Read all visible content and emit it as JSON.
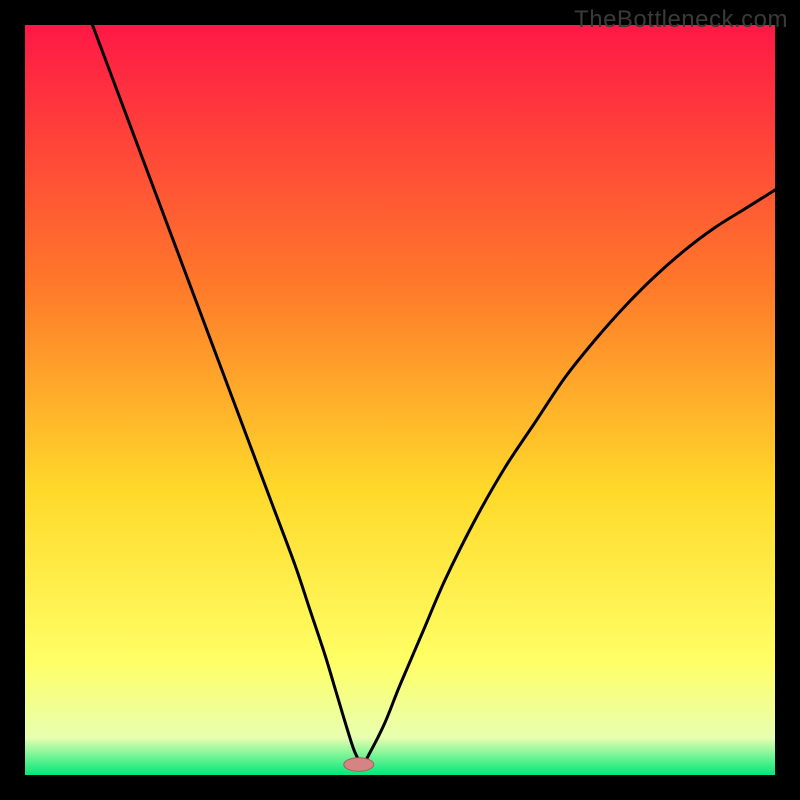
{
  "watermark": "TheBottleneck.com",
  "colors": {
    "frame": "#000000",
    "curve": "#000000",
    "marker_fill": "#d68383",
    "marker_stroke": "#a85c5c",
    "grad_top": "#ff1846",
    "grad_mid1": "#ff7a2a",
    "grad_mid2": "#ffd92a",
    "grad_mid3": "#ffff66",
    "grad_mid4": "#e8ffb0",
    "grad_bot": "#00e87a"
  },
  "chart_data": {
    "type": "line",
    "title": "",
    "xlabel": "",
    "ylabel": "",
    "xlim": [
      0,
      100
    ],
    "ylim": [
      0,
      100
    ],
    "annotations": [],
    "series": [
      {
        "name": "bottleneck-curve",
        "x": [
          9,
          12,
          15,
          18,
          21,
          24,
          27,
          30,
          33,
          36,
          38,
          40,
          41.5,
          43,
          44,
          45,
          46,
          48,
          50,
          53,
          56,
          60,
          64,
          68,
          72,
          76,
          80,
          84,
          88,
          92,
          96,
          100
        ],
        "y": [
          100,
          92,
          84,
          76,
          68,
          60,
          52,
          44,
          36,
          28,
          22,
          16,
          11,
          6,
          3,
          1.5,
          3,
          7,
          12,
          19,
          26,
          34,
          41,
          47,
          53,
          58,
          62.5,
          66.5,
          70,
          73,
          75.5,
          78
        ]
      }
    ],
    "marker": {
      "x": 44.5,
      "y": 1.4,
      "rx": 2.0,
      "ry": 0.9
    }
  }
}
